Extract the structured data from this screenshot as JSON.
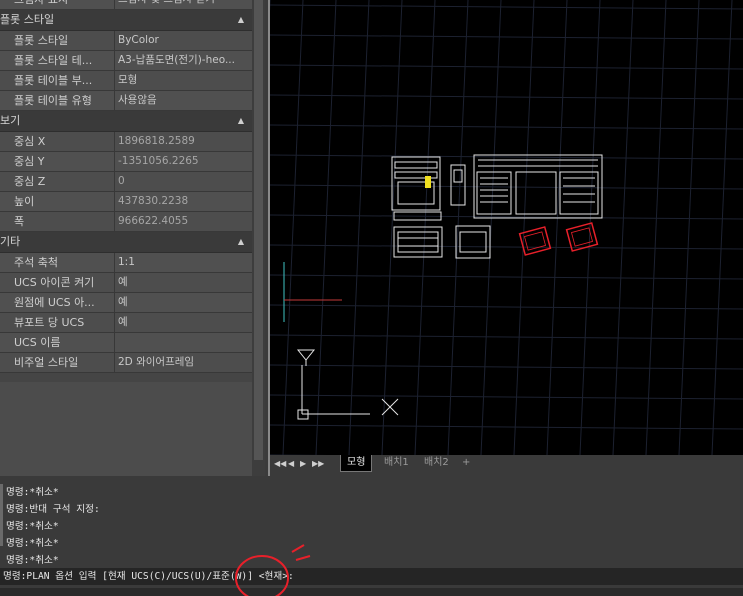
{
  "properties": {
    "sections": [
      {
        "title": "",
        "rows": [
          {
            "label": "그림자 표시",
            "value": "그림자 및 그림자 받기"
          }
        ]
      },
      {
        "title": "플롯 스타일",
        "rows": [
          {
            "label": "플롯 스타일",
            "value": "ByColor"
          },
          {
            "label": "플롯 스타일 테...",
            "value": "A3-납품도면(전기)-heo..."
          },
          {
            "label": "플롯 테이블 부...",
            "value": "모형"
          },
          {
            "label": "플롯 테이블 유형",
            "value": "사용않음"
          }
        ]
      },
      {
        "title": "보기",
        "rows": [
          {
            "label": "중심 X",
            "value": "1896818.2589"
          },
          {
            "label": "중심 Y",
            "value": "-1351056.2265"
          },
          {
            "label": "중심 Z",
            "value": "0"
          },
          {
            "label": "높이",
            "value": "437830.2238"
          },
          {
            "label": "폭",
            "value": "966622.4055"
          }
        ]
      },
      {
        "title": "기타",
        "rows": [
          {
            "label": "주석 축척",
            "value": "1:1"
          },
          {
            "label": "UCS 아이콘 켜기",
            "value": "예"
          },
          {
            "label": "원점에 UCS 아...",
            "value": "예"
          },
          {
            "label": "뷰포트 당 UCS",
            "value": "예"
          },
          {
            "label": "UCS 이름",
            "value": ""
          },
          {
            "label": "비주얼 스타일",
            "value": "2D 와이어프레임"
          }
        ]
      }
    ]
  },
  "tabs": [
    "모형",
    "배치1",
    "배치2",
    "+"
  ],
  "nav_arrows": [
    "◀◀",
    "◀",
    "▶",
    "▶▶"
  ],
  "command_history": [
    "명령:*취소*",
    "명령:반대 구석 지정:",
    "명령:*취소*",
    "명령:*취소*",
    "명령:*취소*"
  ],
  "command_prompt": "명령:PLAN 옵션 입력 [현재 UCS(C)/UCS(U)/표준(W)] <현재>:",
  "colors": {
    "viewport": "#000000",
    "grid": "#1b1f2a",
    "annotation": "#e8202a"
  }
}
